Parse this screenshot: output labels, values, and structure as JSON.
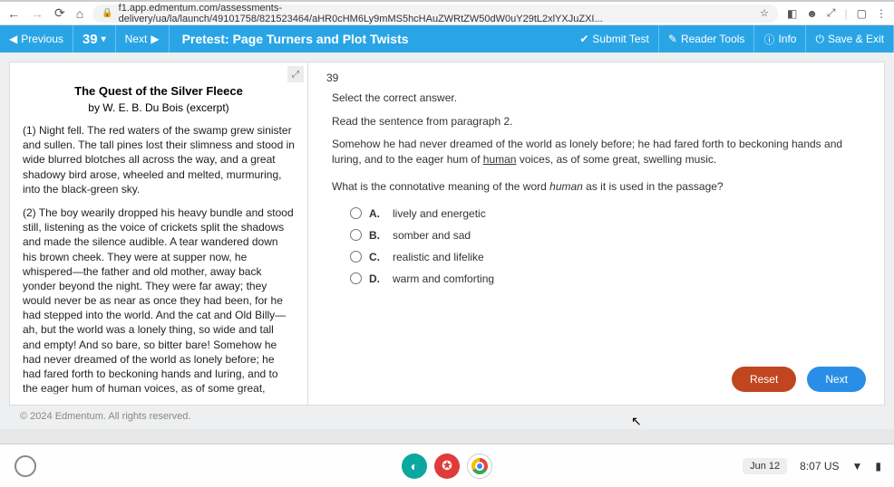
{
  "browser": {
    "url": "f1.app.edmentum.com/assessments-delivery/ua/la/launch/49101758/821523464/aHR0cHM6Ly9mMS5hcHAuZWRtZW50dW0uY29tL2xlYXJuZXI..."
  },
  "header": {
    "previous": "Previous",
    "qnum": "39",
    "next": "Next",
    "title": "Pretest: Page Turners and Plot Twists",
    "submit": "Submit Test",
    "tools": "Reader Tools",
    "info": "Info",
    "save_exit": "Save & Exit"
  },
  "passage": {
    "title": "The Quest of the Silver Fleece",
    "byline": "by W. E. B. Du Bois (excerpt)",
    "p1": "(1) Night fell. The red waters of the swamp grew sinister and sullen. The tall pines lost their slimness and stood in wide blurred blotches all across the way, and a great shadowy bird arose, wheeled and melted, murmuring, into the black-green sky.",
    "p2": "(2) The boy wearily dropped his heavy bundle and stood still, listening as the voice of crickets split the shadows and made the silence audible. A tear wandered down his brown cheek. They were at supper now, he whispered—the father and old mother, away back yonder beyond the night. They were far away; they would never be as near as once they had been, for he had stepped into the world. And the cat and Old Billy—ah, but the world was a lonely thing, so wide and tall and empty! And so bare, so bitter bare! Somehow he had never dreamed of the world as lonely before; he had fared forth to beckoning hands and luring, and to the eager hum of human voices, as of some great,"
  },
  "question": {
    "number": "39",
    "select": "Select the correct answer.",
    "read": "Read the sentence from paragraph 2.",
    "quote_a": "Somehow he had never dreamed of the world as lonely before; he had fared forth to beckoning hands and luring, and to the eager hum of ",
    "quote_u": "human",
    "quote_b": " voices, as of some great, swelling music.",
    "prompt_a": "What is the connotative meaning of the word ",
    "prompt_i": "human",
    "prompt_b": " as it is used in the passage?",
    "options": [
      {
        "letter": "A.",
        "text": "lively and energetic"
      },
      {
        "letter": "B.",
        "text": "somber and sad"
      },
      {
        "letter": "C.",
        "text": "realistic and lifelike"
      },
      {
        "letter": "D.",
        "text": "warm and comforting"
      }
    ],
    "reset": "Reset",
    "next": "Next"
  },
  "footer": {
    "copyright": "© 2024 Edmentum. All rights reserved."
  },
  "taskbar": {
    "date": "Jun 12",
    "time": "8:07 US"
  }
}
